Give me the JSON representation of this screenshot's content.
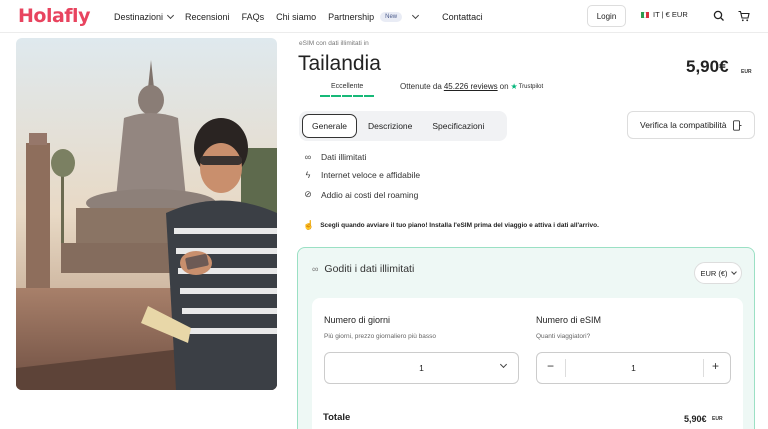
{
  "header": {
    "logo": "Holafly",
    "nav": [
      {
        "label": "Destinazioni",
        "has_chevron": true
      },
      {
        "label": "Recensioni",
        "has_chevron": false
      },
      {
        "label": "FAQs",
        "has_chevron": false
      },
      {
        "label": "Chi siamo",
        "has_chevron": false
      },
      {
        "label": "Partnership",
        "has_chevron": true,
        "badge": "New"
      },
      {
        "label": "Contattaci",
        "has_chevron": false
      }
    ],
    "login_label": "Login",
    "locale_label": "IT | € EUR",
    "icons": [
      "search-icon",
      "cart-icon"
    ],
    "brand_color": "#e8445f"
  },
  "product": {
    "subtitle": "eSIM con dati illimitati in",
    "title": "Tailandia",
    "price": "5,90€",
    "price_currency": "EUR",
    "rating_word": "Eccellente",
    "reviews_prefix": "Ottenute da",
    "reviews_count": "45.226 reviews",
    "reviews_on": "on",
    "trustpilot": "Trustpilot",
    "star_color": "#17b978"
  },
  "tabs": [
    {
      "label": "Generale",
      "active": true
    },
    {
      "label": "Descrizione",
      "active": false
    },
    {
      "label": "Specificazioni",
      "active": false
    }
  ],
  "compat_button": "Verifica la compatibilità",
  "features": [
    {
      "icon": "infinity-icon",
      "label": "Dati illimitati"
    },
    {
      "icon": "bolt-icon",
      "label": "Internet veloce e affidabile"
    },
    {
      "icon": "no-roaming-icon",
      "label": "Addio ai costi del roaming"
    }
  ],
  "note": "Scegli quando avviare il tuo piano! Installa l'eSIM prima del viaggio e attiva i dati all'arrivo.",
  "plan": {
    "title": "Goditi i dati illimitati",
    "currency_select": "EUR (€)",
    "days_label": "Numero di giorni",
    "days_help": "Più giorni, prezzo giornaliero più basso",
    "days_value": "1",
    "esim_label": "Numero di eSIM",
    "esim_help": "Quanti viaggiatori?",
    "esim_value": "1",
    "minus": "−",
    "plus": "+",
    "total_label": "Totale",
    "total_price": "5,90€",
    "total_currency": "EUR",
    "accent_border": "#9be0c4",
    "accent_bg": "#eef8f5"
  }
}
